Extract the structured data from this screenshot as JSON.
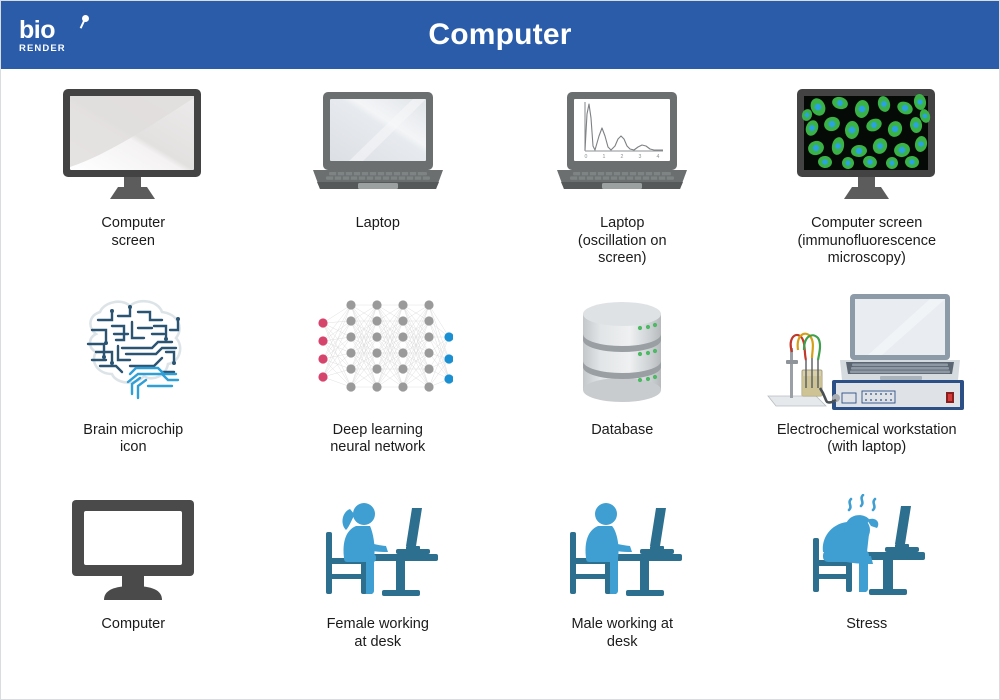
{
  "header": {
    "title": "Computer",
    "logo_primary": "bio",
    "logo_secondary": "RENDER",
    "background_color": "#2a5caa",
    "title_color": "#ffffff"
  },
  "palette": {
    "header_blue": "#2a5caa",
    "icon_dark_gray": "#434343",
    "icon_mid_gray": "#6b6f70",
    "screen_light": "#e6e4e4",
    "cell_green": "#2fb344",
    "nucleus_cyan": "#27a3dd",
    "circuit_dark_blue": "#2b5472",
    "circuit_light_blue": "#2f9fd6",
    "node_pink": "#d6436b",
    "node_blue": "#1a8fd1",
    "node_gray": "#9a9a9a",
    "database_gray": "#d4d7da",
    "database_led": "#4cb963",
    "figure_light_blue": "#3f9fd2",
    "figure_dark_blue": "#2d6f8e",
    "instrument_blue": "#2c4f86",
    "caption_color": "#1b1b1b"
  },
  "items": [
    {
      "id": "computer-screen",
      "label": "Computer\nscreen",
      "icon": "monitor-gradient-icon"
    },
    {
      "id": "laptop",
      "label": "Laptop",
      "icon": "laptop-icon"
    },
    {
      "id": "laptop-oscillation",
      "label": "Laptop\n(oscillation on\nscreen)",
      "icon": "laptop-oscillation-icon"
    },
    {
      "id": "computer-screen-immunofluorescence",
      "label": "Computer screen\n(immunofluorescence\nmicroscopy)",
      "icon": "monitor-microscopy-icon"
    },
    {
      "id": "brain-microchip",
      "label": "Brain microchip\nicon",
      "icon": "brain-circuit-icon"
    },
    {
      "id": "deep-learning",
      "label": "Deep learning\nneural network",
      "icon": "neural-network-icon"
    },
    {
      "id": "database",
      "label": "Database",
      "icon": "database-cylinder-icon"
    },
    {
      "id": "electrochemical-workstation",
      "label": "Electrochemical workstation\n(with laptop)",
      "icon": "electrochemical-workstation-icon"
    },
    {
      "id": "computer",
      "label": "Computer",
      "icon": "monitor-flat-icon"
    },
    {
      "id": "female-working-at-desk",
      "label": "Female working\nat desk",
      "icon": "female-at-desk-icon"
    },
    {
      "id": "male-working-at-desk",
      "label": "Male working at\ndesk",
      "icon": "male-at-desk-icon"
    },
    {
      "id": "stress",
      "label": "Stress",
      "icon": "stressed-person-icon"
    }
  ],
  "oscillation_chart": {
    "type": "line",
    "title": "",
    "xlabel": "",
    "ylabel": "",
    "tick_labels": [
      "0",
      "1",
      "2",
      "3",
      "4"
    ],
    "x": [
      0,
      0.15,
      0.3,
      0.45,
      0.6,
      0.8,
      1.0,
      1.2,
      1.4,
      1.6,
      1.8,
      2.0,
      2.2,
      2.5,
      2.8,
      3.0,
      3.3,
      3.6,
      4.0
    ],
    "y": [
      0.05,
      0.95,
      0.2,
      0.55,
      0.12,
      0.05,
      0.1,
      0.34,
      0.33,
      0.12,
      0.05,
      0.07,
      0.16,
      0.13,
      0.06,
      0.05,
      0.09,
      0.07,
      0.06
    ],
    "xlim": [
      0,
      4.4
    ],
    "ylim": [
      0,
      1
    ],
    "grid": false,
    "legend": "none"
  }
}
